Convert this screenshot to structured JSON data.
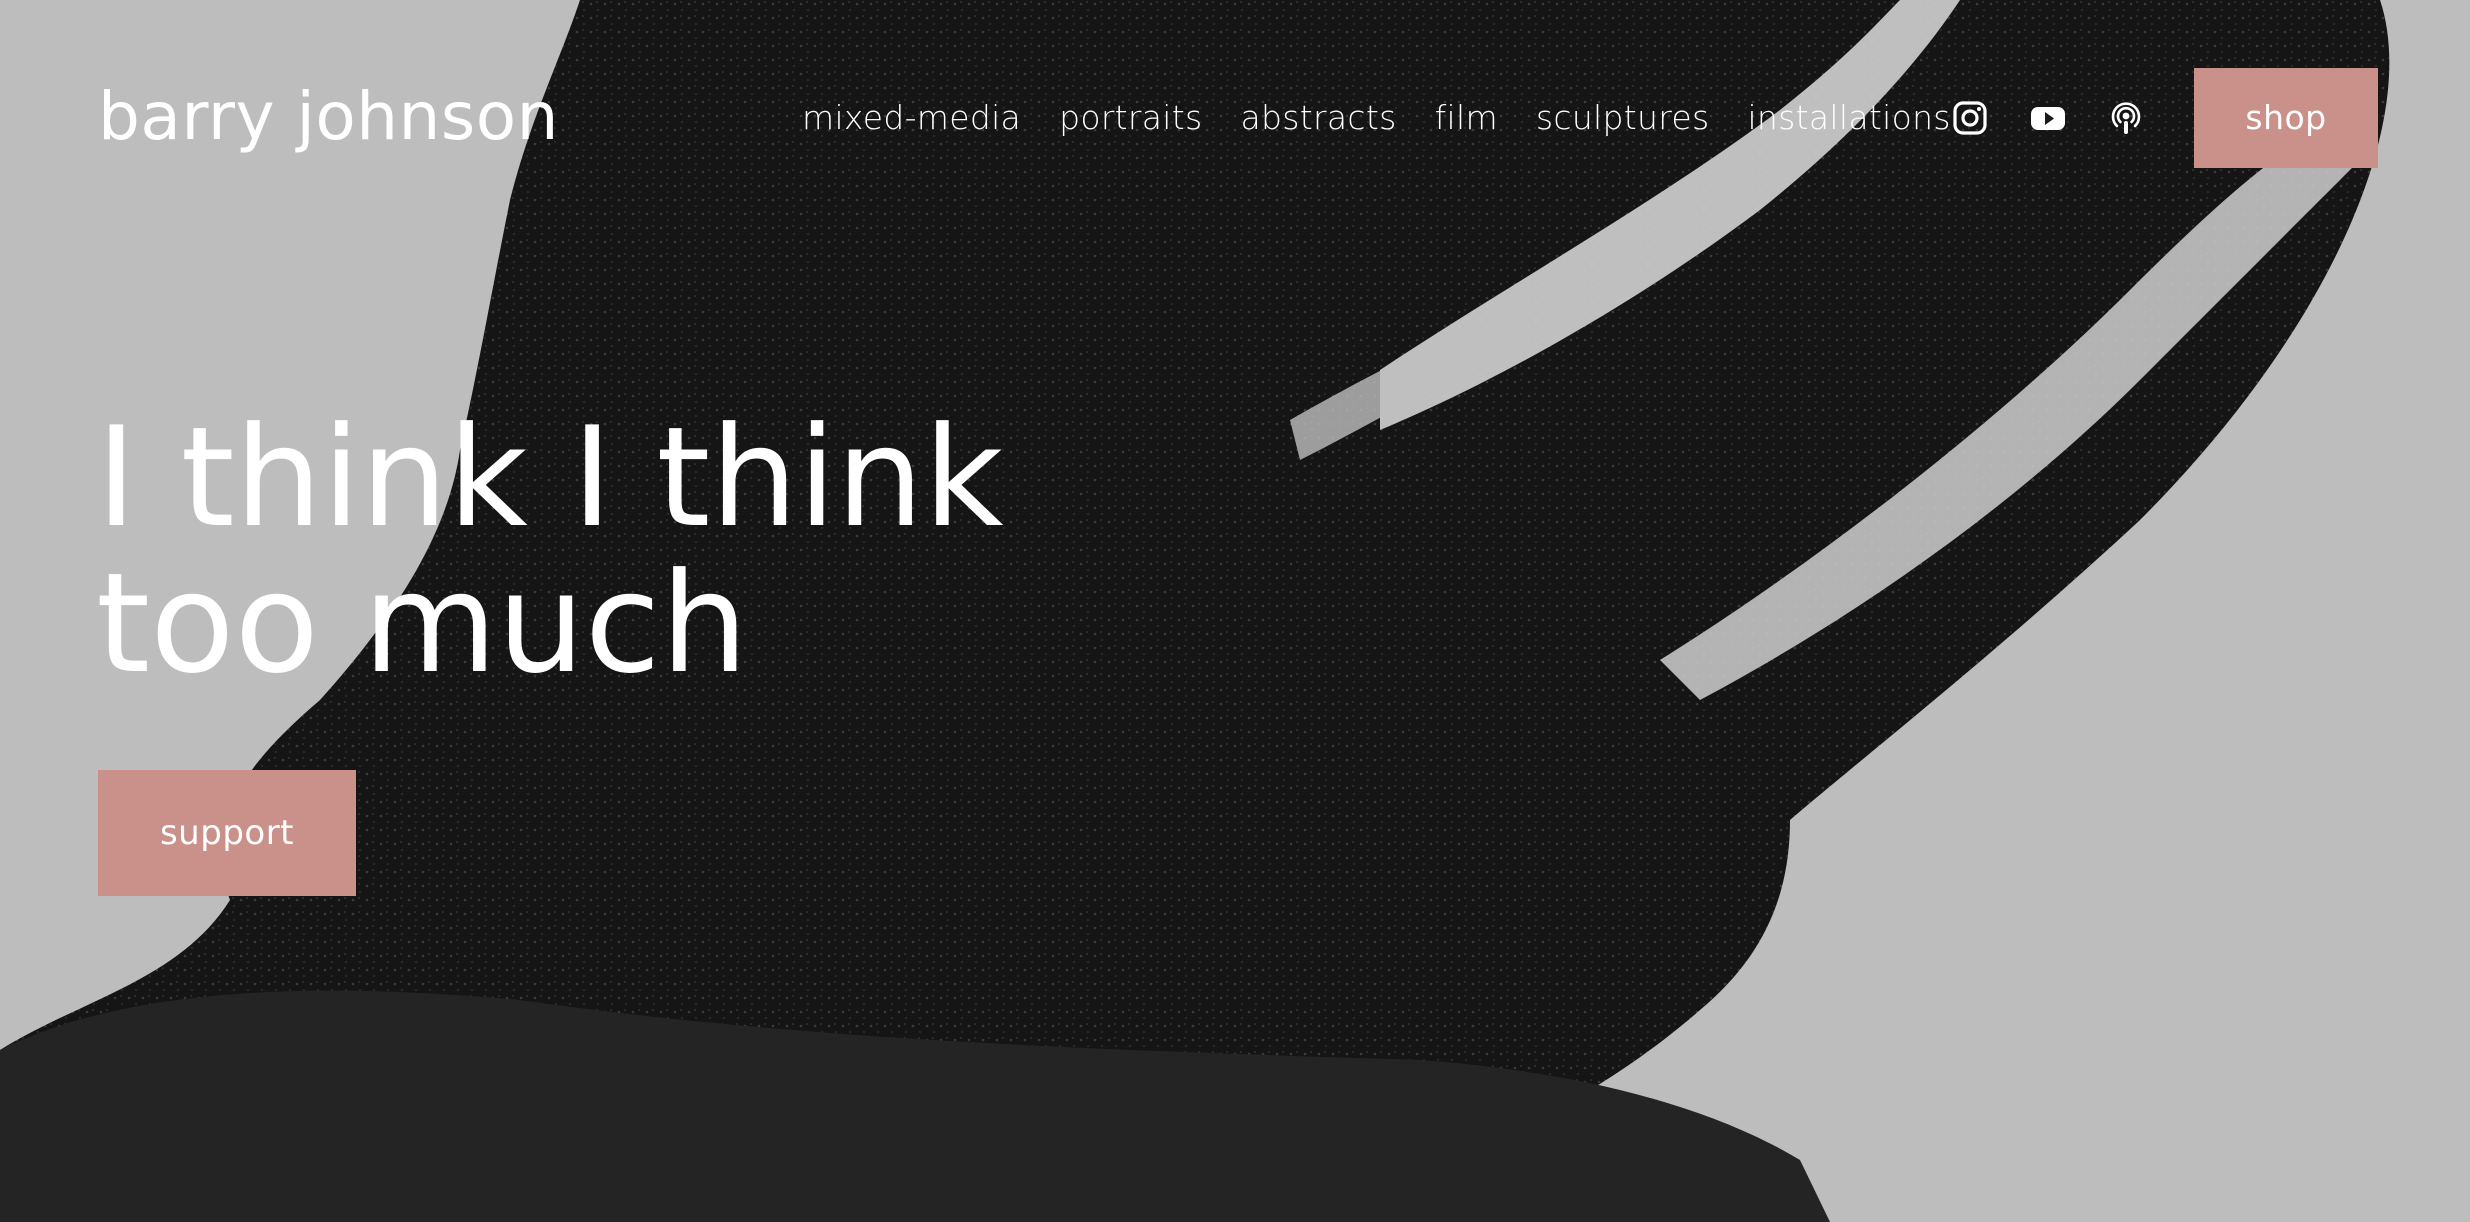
{
  "header": {
    "site_title": "barry johnson",
    "nav": [
      {
        "label": "mixed-media"
      },
      {
        "label": "portraits"
      },
      {
        "label": "abstracts"
      },
      {
        "label": "film"
      },
      {
        "label": "sculptures"
      },
      {
        "label": "installations"
      }
    ],
    "social_icons": [
      "instagram-icon",
      "youtube-icon",
      "podcast-icon"
    ],
    "shop_label": "shop"
  },
  "hero": {
    "title": "I think I think too much",
    "support_label": "support"
  },
  "colors": {
    "accent": "#c99189",
    "text": "#ffffff",
    "background": "#b9b9b9"
  }
}
